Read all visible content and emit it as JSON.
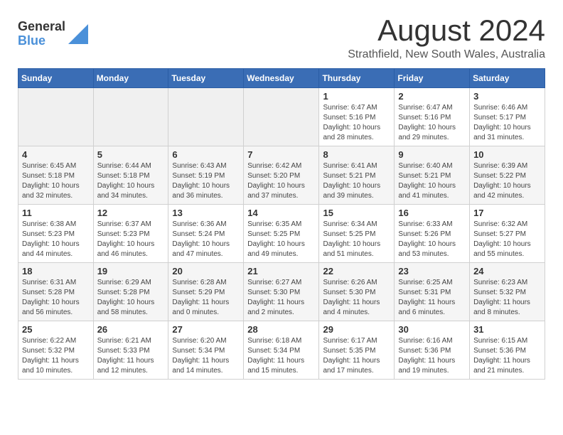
{
  "header": {
    "logo_general": "General",
    "logo_blue": "Blue",
    "month_year": "August 2024",
    "location": "Strathfield, New South Wales, Australia"
  },
  "calendar": {
    "headers": [
      "Sunday",
      "Monday",
      "Tuesday",
      "Wednesday",
      "Thursday",
      "Friday",
      "Saturday"
    ],
    "rows": [
      [
        {
          "day": "",
          "info": ""
        },
        {
          "day": "",
          "info": ""
        },
        {
          "day": "",
          "info": ""
        },
        {
          "day": "",
          "info": ""
        },
        {
          "day": "1",
          "info": "Sunrise: 6:47 AM\nSunset: 5:16 PM\nDaylight: 10 hours\nand 28 minutes."
        },
        {
          "day": "2",
          "info": "Sunrise: 6:47 AM\nSunset: 5:16 PM\nDaylight: 10 hours\nand 29 minutes."
        },
        {
          "day": "3",
          "info": "Sunrise: 6:46 AM\nSunset: 5:17 PM\nDaylight: 10 hours\nand 31 minutes."
        }
      ],
      [
        {
          "day": "4",
          "info": "Sunrise: 6:45 AM\nSunset: 5:18 PM\nDaylight: 10 hours\nand 32 minutes."
        },
        {
          "day": "5",
          "info": "Sunrise: 6:44 AM\nSunset: 5:18 PM\nDaylight: 10 hours\nand 34 minutes."
        },
        {
          "day": "6",
          "info": "Sunrise: 6:43 AM\nSunset: 5:19 PM\nDaylight: 10 hours\nand 36 minutes."
        },
        {
          "day": "7",
          "info": "Sunrise: 6:42 AM\nSunset: 5:20 PM\nDaylight: 10 hours\nand 37 minutes."
        },
        {
          "day": "8",
          "info": "Sunrise: 6:41 AM\nSunset: 5:21 PM\nDaylight: 10 hours\nand 39 minutes."
        },
        {
          "day": "9",
          "info": "Sunrise: 6:40 AM\nSunset: 5:21 PM\nDaylight: 10 hours\nand 41 minutes."
        },
        {
          "day": "10",
          "info": "Sunrise: 6:39 AM\nSunset: 5:22 PM\nDaylight: 10 hours\nand 42 minutes."
        }
      ],
      [
        {
          "day": "11",
          "info": "Sunrise: 6:38 AM\nSunset: 5:23 PM\nDaylight: 10 hours\nand 44 minutes."
        },
        {
          "day": "12",
          "info": "Sunrise: 6:37 AM\nSunset: 5:23 PM\nDaylight: 10 hours\nand 46 minutes."
        },
        {
          "day": "13",
          "info": "Sunrise: 6:36 AM\nSunset: 5:24 PM\nDaylight: 10 hours\nand 47 minutes."
        },
        {
          "day": "14",
          "info": "Sunrise: 6:35 AM\nSunset: 5:25 PM\nDaylight: 10 hours\nand 49 minutes."
        },
        {
          "day": "15",
          "info": "Sunrise: 6:34 AM\nSunset: 5:25 PM\nDaylight: 10 hours\nand 51 minutes."
        },
        {
          "day": "16",
          "info": "Sunrise: 6:33 AM\nSunset: 5:26 PM\nDaylight: 10 hours\nand 53 minutes."
        },
        {
          "day": "17",
          "info": "Sunrise: 6:32 AM\nSunset: 5:27 PM\nDaylight: 10 hours\nand 55 minutes."
        }
      ],
      [
        {
          "day": "18",
          "info": "Sunrise: 6:31 AM\nSunset: 5:28 PM\nDaylight: 10 hours\nand 56 minutes."
        },
        {
          "day": "19",
          "info": "Sunrise: 6:29 AM\nSunset: 5:28 PM\nDaylight: 10 hours\nand 58 minutes."
        },
        {
          "day": "20",
          "info": "Sunrise: 6:28 AM\nSunset: 5:29 PM\nDaylight: 11 hours\nand 0 minutes."
        },
        {
          "day": "21",
          "info": "Sunrise: 6:27 AM\nSunset: 5:30 PM\nDaylight: 11 hours\nand 2 minutes."
        },
        {
          "day": "22",
          "info": "Sunrise: 6:26 AM\nSunset: 5:30 PM\nDaylight: 11 hours\nand 4 minutes."
        },
        {
          "day": "23",
          "info": "Sunrise: 6:25 AM\nSunset: 5:31 PM\nDaylight: 11 hours\nand 6 minutes."
        },
        {
          "day": "24",
          "info": "Sunrise: 6:23 AM\nSunset: 5:32 PM\nDaylight: 11 hours\nand 8 minutes."
        }
      ],
      [
        {
          "day": "25",
          "info": "Sunrise: 6:22 AM\nSunset: 5:32 PM\nDaylight: 11 hours\nand 10 minutes."
        },
        {
          "day": "26",
          "info": "Sunrise: 6:21 AM\nSunset: 5:33 PM\nDaylight: 11 hours\nand 12 minutes."
        },
        {
          "day": "27",
          "info": "Sunrise: 6:20 AM\nSunset: 5:34 PM\nDaylight: 11 hours\nand 14 minutes."
        },
        {
          "day": "28",
          "info": "Sunrise: 6:18 AM\nSunset: 5:34 PM\nDaylight: 11 hours\nand 15 minutes."
        },
        {
          "day": "29",
          "info": "Sunrise: 6:17 AM\nSunset: 5:35 PM\nDaylight: 11 hours\nand 17 minutes."
        },
        {
          "day": "30",
          "info": "Sunrise: 6:16 AM\nSunset: 5:36 PM\nDaylight: 11 hours\nand 19 minutes."
        },
        {
          "day": "31",
          "info": "Sunrise: 6:15 AM\nSunset: 5:36 PM\nDaylight: 11 hours\nand 21 minutes."
        }
      ]
    ]
  }
}
